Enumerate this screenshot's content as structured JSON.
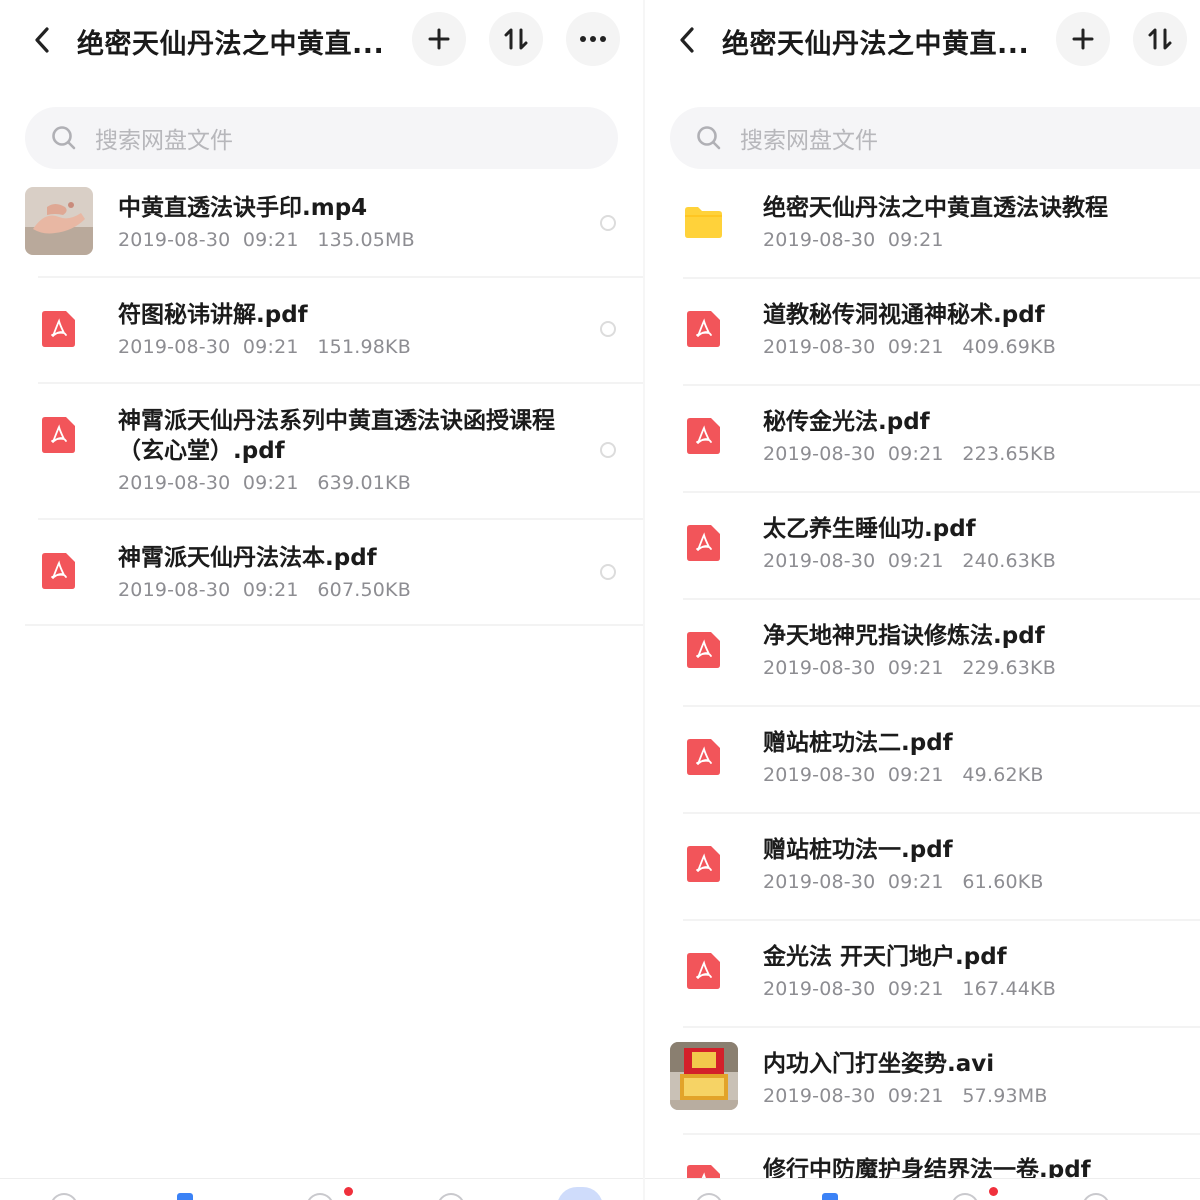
{
  "left": {
    "title": "绝密天仙丹法之中黄直...",
    "search_placeholder": "搜索网盘文件",
    "files": [
      {
        "name": "中黄直透法诀手印.mp4",
        "meta": "2019-08-30  09:21   135.05MB",
        "type": "video-thumb-hands"
      },
      {
        "name": "符图秘讳讲解.pdf",
        "meta": "2019-08-30  09:21   151.98KB",
        "type": "pdf"
      },
      {
        "name": "神霄派天仙丹法系列中黄直透法诀函授课程（玄心堂）.pdf",
        "meta": "2019-08-30  09:21   639.01KB",
        "type": "pdf"
      },
      {
        "name": "神霄派天仙丹法法本.pdf",
        "meta": "2019-08-30  09:21   607.50KB",
        "type": "pdf"
      }
    ]
  },
  "right": {
    "title": "绝密天仙丹法之中黄直...",
    "search_placeholder": "搜索网盘文件",
    "files": [
      {
        "name": "绝密天仙丹法之中黄直透法诀教程",
        "meta": "2019-08-30  09:21",
        "type": "folder"
      },
      {
        "name": "道教秘传洞视通神秘术.pdf",
        "meta": "2019-08-30  09:21   409.69KB",
        "type": "pdf"
      },
      {
        "name": "秘传金光法.pdf",
        "meta": "2019-08-30  09:21   223.65KB",
        "type": "pdf"
      },
      {
        "name": "太乙养生睡仙功.pdf",
        "meta": "2019-08-30  09:21   240.63KB",
        "type": "pdf"
      },
      {
        "name": "净天地神咒指诀修炼法.pdf",
        "meta": "2019-08-30  09:21   229.63KB",
        "type": "pdf"
      },
      {
        "name": "赠站桩功法二.pdf",
        "meta": "2019-08-30  09:21   49.62KB",
        "type": "pdf"
      },
      {
        "name": "赠站桩功法一.pdf",
        "meta": "2019-08-30  09:21   61.60KB",
        "type": "pdf"
      },
      {
        "name": "金光法 开天门地户.pdf",
        "meta": "2019-08-30  09:21   167.44KB",
        "type": "pdf"
      },
      {
        "name": "内功入门打坐姿势.avi",
        "meta": "2019-08-30  09:21   57.93MB",
        "type": "video-thumb-altar"
      },
      {
        "name": "修行中防魔护身结界法一卷.pdf",
        "meta": "",
        "type": "pdf"
      }
    ]
  },
  "icons": {
    "back": "chevron-left-icon",
    "add": "plus-icon",
    "sort": "sort-arrows-icon",
    "more": "more-dots-icon",
    "search": "search-icon",
    "pdf": "pdf-icon",
    "folder": "folder-icon"
  },
  "colors": {
    "pdf_red": "#f2555a",
    "folder_yellow": "#ffd23a",
    "tab_active": "#3b82f6",
    "badge_red": "#f0303c"
  }
}
